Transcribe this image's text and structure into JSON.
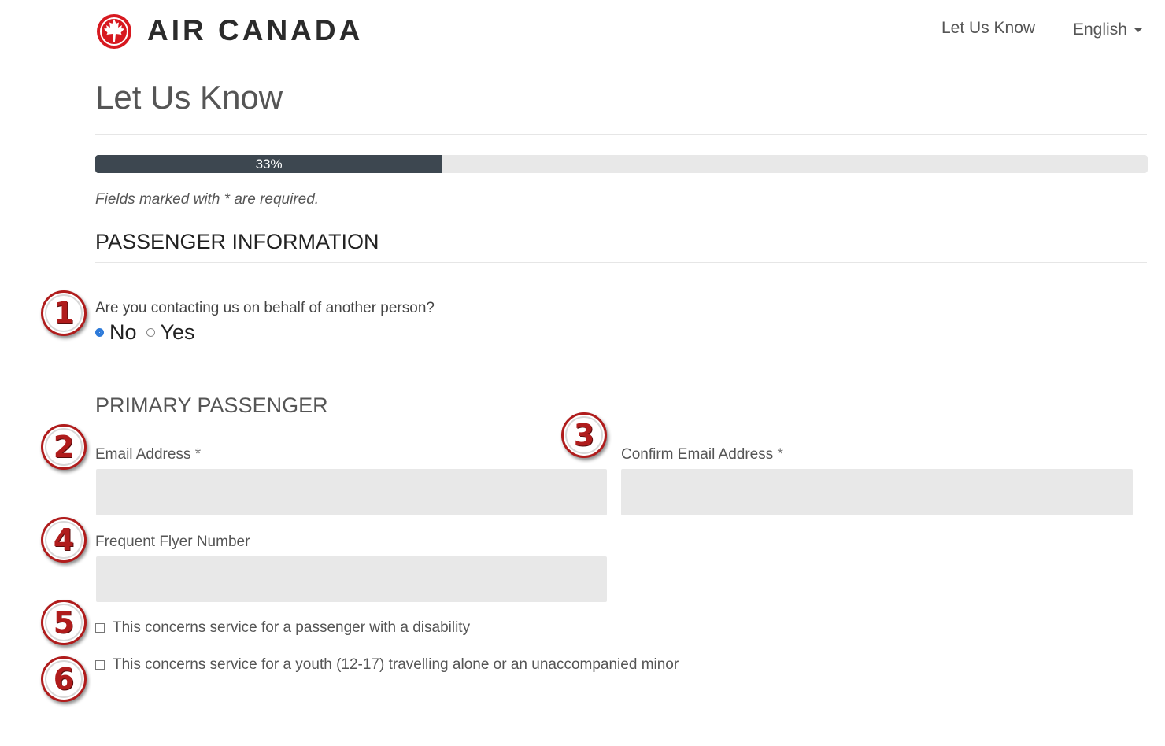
{
  "header": {
    "brand": "AIR CANADA",
    "nav_link": "Let Us Know",
    "language": "English",
    "logo_icon": "maple-leaf-roundel-icon",
    "accent_color": "#d71920"
  },
  "page": {
    "title": "Let Us Know"
  },
  "progress": {
    "value": 0.33,
    "label": "33%"
  },
  "form": {
    "required_note": "Fields marked with * are required.",
    "section_title": "PASSENGER INFORMATION",
    "behalf_question": {
      "label": "Are you contacting us on behalf of another person?",
      "options": [
        "No",
        "Yes"
      ],
      "selected": "No"
    },
    "subsection_title": "PRIMARY PASSENGER",
    "email": {
      "label": "Email Address",
      "required_mark": "*",
      "value": ""
    },
    "confirm_email": {
      "label": "Confirm Email Address",
      "required_mark": "*",
      "value": ""
    },
    "frequent_flyer": {
      "label": "Frequent Flyer Number",
      "value": ""
    },
    "checkboxes": [
      {
        "label": "This concerns service for a passenger with a disability",
        "checked": false
      },
      {
        "label": "This concerns service for a youth (12-17) travelling alone or an unaccompanied minor",
        "checked": false
      }
    ]
  },
  "annotations": [
    "1",
    "2",
    "3",
    "4",
    "5",
    "6"
  ]
}
